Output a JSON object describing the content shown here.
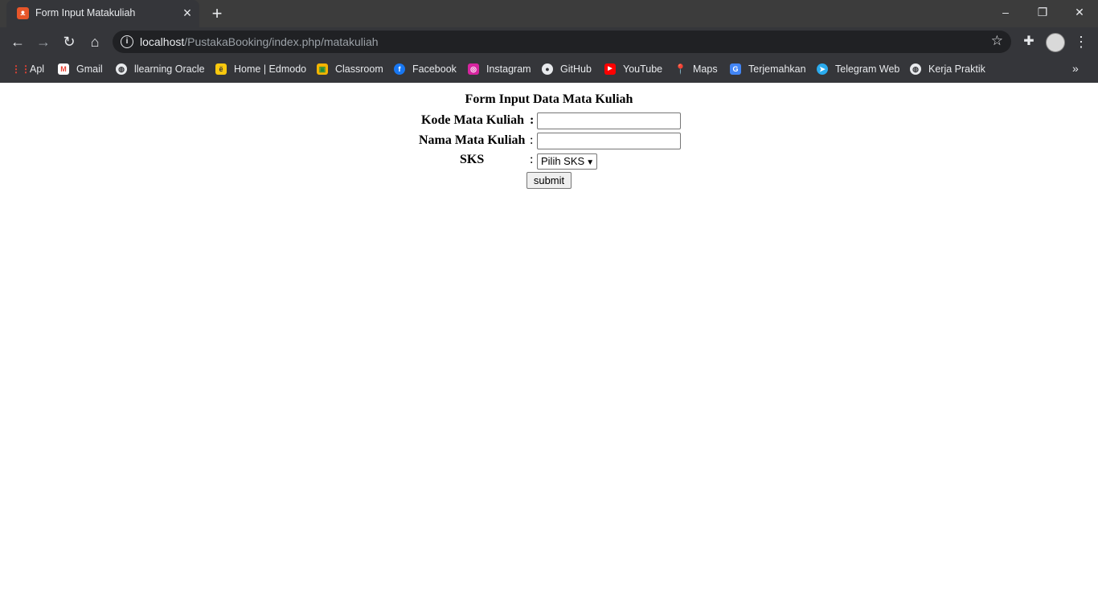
{
  "browser": {
    "tab_title": "Form Input Matakuliah",
    "url_host": "localhost",
    "url_path": "/PustakaBooking/index.php/matakuliah",
    "bookmarks": [
      {
        "label": "Apl",
        "icon": "apps-grid-icon",
        "color": "#ea4335"
      },
      {
        "label": "Gmail",
        "icon": "gmail-icon",
        "color": "#ea4335"
      },
      {
        "label": "llearning Oracle",
        "icon": "globe-icon",
        "color": "#e8eaed"
      },
      {
        "label": "Home | Edmodo",
        "icon": "edmodo-icon",
        "color": "#f9c80e"
      },
      {
        "label": "Classroom",
        "icon": "classroom-icon",
        "color": "#f4b400"
      },
      {
        "label": "Facebook",
        "icon": "facebook-icon",
        "color": "#1877f2"
      },
      {
        "label": "Instagram",
        "icon": "instagram-icon",
        "color": "#d6249f"
      },
      {
        "label": "GitHub",
        "icon": "github-icon",
        "color": "#e8eaed"
      },
      {
        "label": "YouTube",
        "icon": "youtube-icon",
        "color": "#ff0000"
      },
      {
        "label": "Maps",
        "icon": "maps-pin-icon",
        "color": "#34a853"
      },
      {
        "label": "Terjemahkan",
        "icon": "translate-icon",
        "color": "#4285f4"
      },
      {
        "label": "Telegram Web",
        "icon": "telegram-icon",
        "color": "#2aabee"
      },
      {
        "label": "Kerja Praktik",
        "icon": "globe-icon",
        "color": "#e8eaed"
      }
    ]
  },
  "form": {
    "title": "Form Input Data Mata Kuliah",
    "kode_label": "Kode Mata Kuliah",
    "nama_label": "Nama Mata Kuliah",
    "sks_label": "SKS",
    "colon": ":",
    "kode_value": "",
    "nama_value": "",
    "sks_selected": "Pilih SKS",
    "submit_label": "submit"
  }
}
